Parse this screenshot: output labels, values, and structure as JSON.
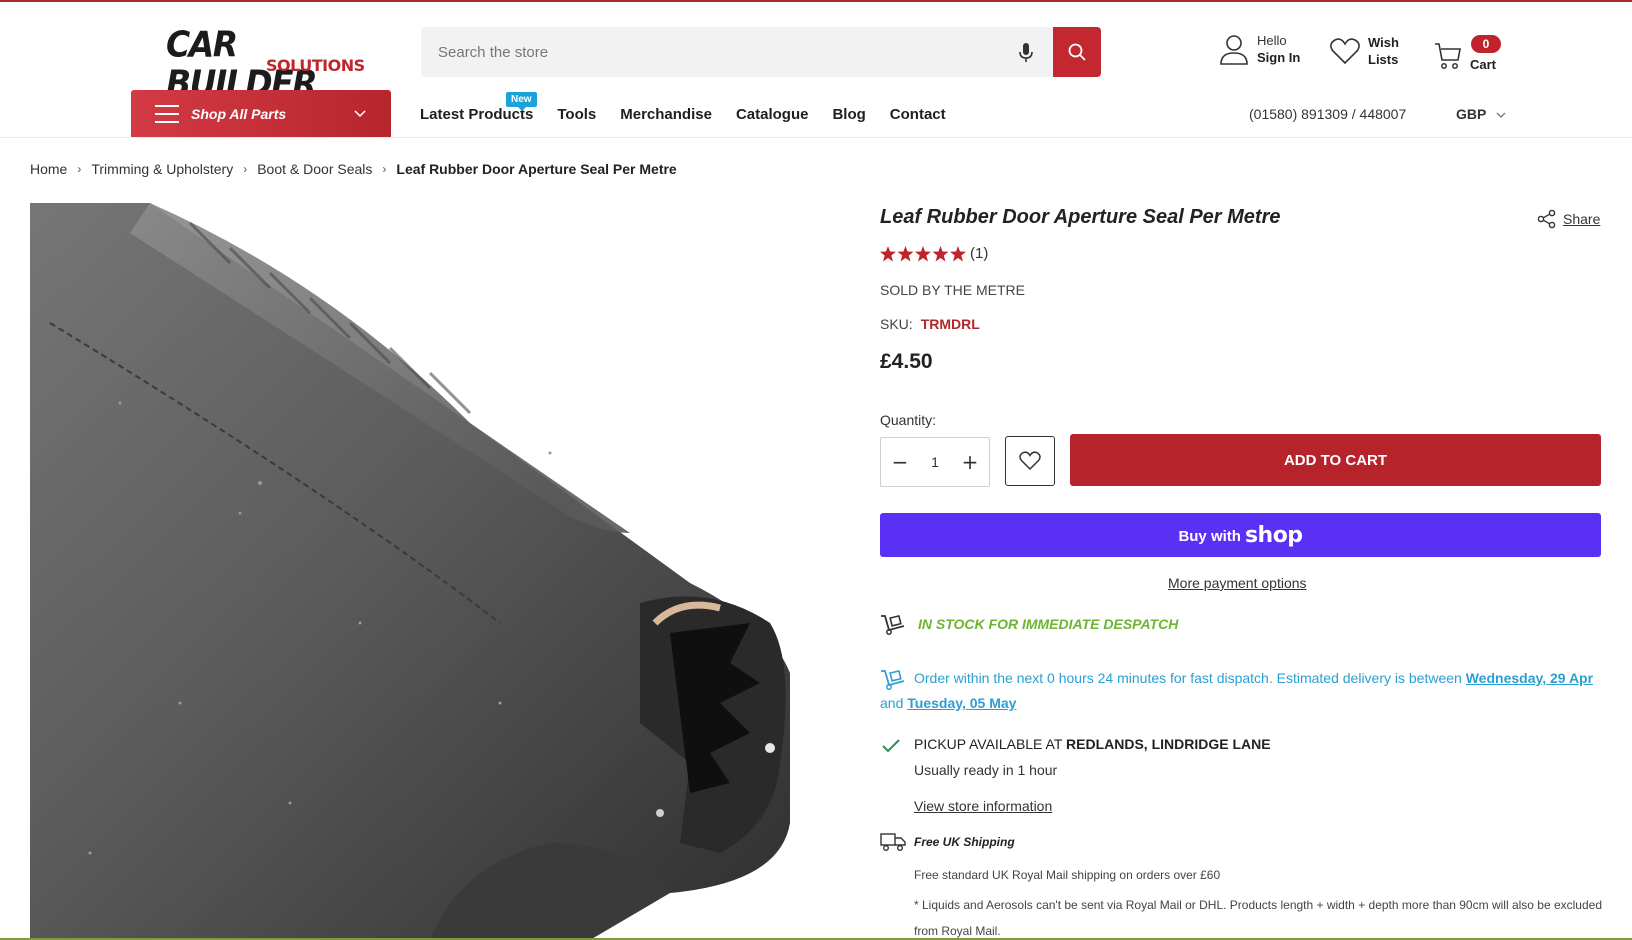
{
  "header": {
    "logo_line1": "CAR BUILDER",
    "logo_line2": "SOLUTIONS",
    "search_placeholder": "Search the store",
    "account": {
      "small": "Hello",
      "big": "Sign In"
    },
    "wishlist": {
      "small": "Wish",
      "big": "Lists"
    },
    "cart": {
      "count": "0",
      "label": "Cart"
    }
  },
  "nav": {
    "shop_all": "Shop All Parts",
    "new_badge": "New",
    "items": [
      "Latest Products",
      "Tools",
      "Merchandise",
      "Catalogue",
      "Blog",
      "Contact"
    ],
    "phone": "(01580) 891309 / 448007",
    "currency": "GBP"
  },
  "breadcrumb": [
    "Home",
    "Trimming & Upholstery",
    "Boot & Door Seals",
    "Leaf Rubber Door Aperture Seal Per Metre"
  ],
  "product": {
    "title": "Leaf Rubber Door Aperture Seal Per Metre",
    "share": "Share",
    "rating": 5,
    "review_count": "(1)",
    "sold_by": "SOLD BY THE METRE",
    "sku_label": "SKU:",
    "sku": "TRMDRL",
    "price": "£4.50",
    "quantity_label": "Quantity:",
    "quantity": "1",
    "add_to_cart": "ADD TO CART",
    "buy_with": "Buy with",
    "shop_word": "shop",
    "more_payment": "More payment options",
    "stock": "IN STOCK FOR IMMEDIATE DESPATCH",
    "order_text": "Order within the next 0 hours 24 minutes for fast dispatch. Estimated delivery is between ",
    "date1": "Wednesday, 29 Apr",
    "and": " and ",
    "date2": "Tuesday, 05 May",
    "pickup_prefix": "PICKUP AVAILABLE AT ",
    "pickup_location": "REDLANDS, LINDRIDGE LANE",
    "pickup_ready": "Usually ready in 1 hour",
    "store_info": "View store information",
    "shipping_heading": "Free UK Shipping",
    "shipping_line1": "Free standard UK Royal Mail shipping on orders over £60",
    "shipping_line2": "* Liquids and Aerosols can't be sent via Royal Mail or DHL. Products length + width + depth more than 90cm will also be excluded from Royal Mail."
  },
  "colors": {
    "brand_red": "#b7232b",
    "shop_purple": "#5a31f4",
    "stock_green": "#6fb331",
    "info_blue": "#2b9fd3",
    "badge_blue": "#1aa3d9"
  }
}
